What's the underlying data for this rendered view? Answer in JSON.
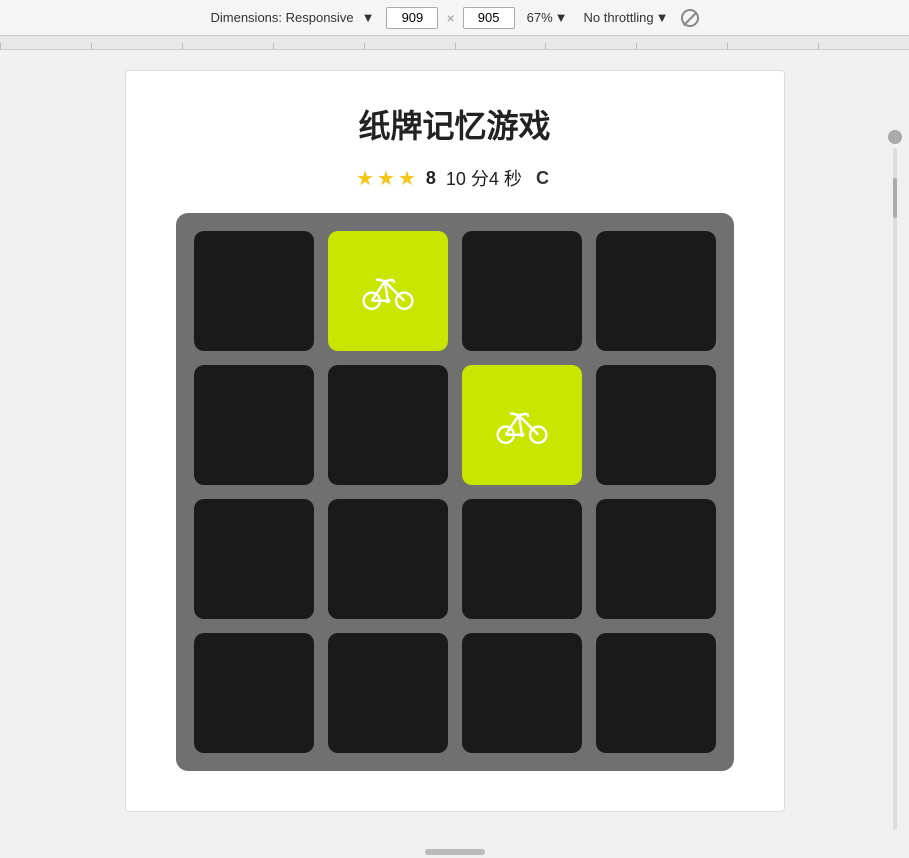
{
  "toolbar": {
    "dimensions_label": "Dimensions: Responsive",
    "dimensions_dropdown_arrow": "▼",
    "width_value": "909",
    "height_value": "905",
    "zoom_label": "67%",
    "zoom_arrow": "▼",
    "throttling_label": "No throttling",
    "throttling_arrow": "▼"
  },
  "game": {
    "title": "纸牌记忆游戏",
    "stars": [
      true,
      true,
      true
    ],
    "score_label": "8",
    "timer_label": "10 分4 秒",
    "reset_label": "C",
    "board": {
      "rows": 4,
      "cols": 4,
      "cards": [
        {
          "id": 0,
          "flipped": false,
          "icon": null
        },
        {
          "id": 1,
          "flipped": true,
          "icon": "bike"
        },
        {
          "id": 2,
          "flipped": false,
          "icon": null
        },
        {
          "id": 3,
          "flipped": false,
          "icon": null
        },
        {
          "id": 4,
          "flipped": false,
          "icon": null
        },
        {
          "id": 5,
          "flipped": false,
          "icon": null
        },
        {
          "id": 6,
          "flipped": true,
          "icon": "bike"
        },
        {
          "id": 7,
          "flipped": false,
          "icon": null
        },
        {
          "id": 8,
          "flipped": false,
          "icon": null
        },
        {
          "id": 9,
          "flipped": false,
          "icon": null
        },
        {
          "id": 10,
          "flipped": false,
          "icon": null
        },
        {
          "id": 11,
          "flipped": false,
          "icon": null
        },
        {
          "id": 12,
          "flipped": false,
          "icon": null
        },
        {
          "id": 13,
          "flipped": false,
          "icon": null
        },
        {
          "id": 14,
          "flipped": false,
          "icon": null
        },
        {
          "id": 15,
          "flipped": false,
          "icon": null
        }
      ]
    }
  }
}
